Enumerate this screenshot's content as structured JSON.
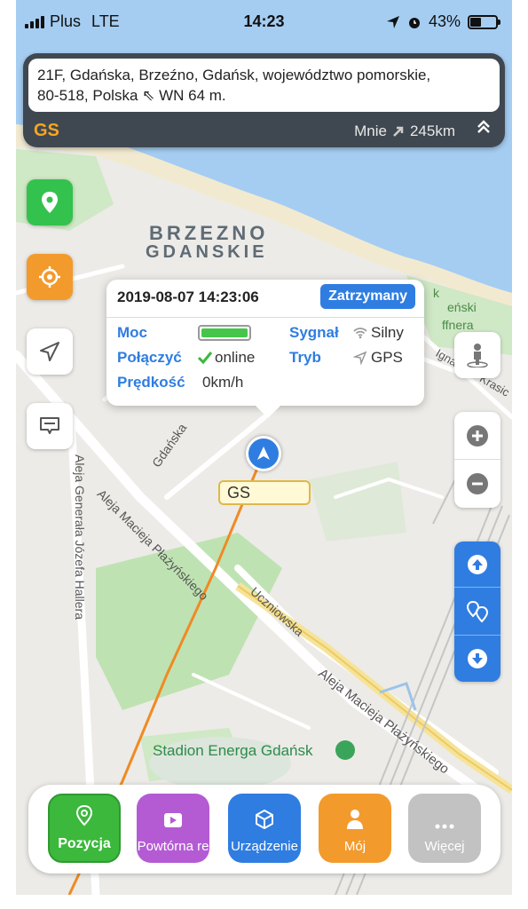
{
  "status_bar": {
    "carrier": "Plus",
    "network": "LTE",
    "time": "14:23",
    "battery_percent": "43%",
    "battery_level": 0.43
  },
  "address": {
    "text_line1": "21F, Gdańska, Brzeźno, Gdańsk, województwo pomorskie,",
    "text_line2": "80-518, Polska ⇖ WN 64 m.",
    "device_name": "GS",
    "distance_label": "Mnie",
    "distance_value": "245km"
  },
  "map": {
    "area_label_line1": "BRZEZNO",
    "area_label_line2": "GDANSKIE",
    "streets": [
      "Gdańska",
      "Aleja Macieja Płażyńskiego",
      "Uczniowska",
      "Aleja Generała Józefa Hallera",
      "Aleja Macieja Płażyńskiego",
      "Ignacego Krasic"
    ],
    "poi": "Stadion Energa Gdańsk",
    "partial_labels": [
      "eński",
      "ffnera",
      "k"
    ],
    "marker_label": "GS"
  },
  "popup": {
    "datetime": "2019-08-07 14:23:06",
    "status": "Zatrzymany",
    "power_label": "Moc",
    "signal_label": "Sygnał",
    "signal_value": "Silny",
    "connect_label": "Połączyć",
    "connect_value": "online",
    "mode_label": "Tryb",
    "mode_value": "GPS",
    "speed_label": "Prędkość",
    "speed_value": "0km/h"
  },
  "bottom_nav": [
    {
      "label": "Pozycja",
      "color": "#3cb83c"
    },
    {
      "label": "Powtórna re",
      "color": "#b45bd4"
    },
    {
      "label": "Urządzenie",
      "color": "#2f7de1"
    },
    {
      "label": "Mój",
      "color": "#f39a2d"
    },
    {
      "label": "Więcej",
      "color": "#c2c2c2"
    }
  ],
  "colors": {
    "accent_blue": "#2f7de1",
    "green": "#33c24d",
    "orange": "#f39a2d",
    "device_name": "#f5a623",
    "sea": "#a5cdf2"
  },
  "icons": [
    "location-pin-icon",
    "target-icon",
    "send-icon",
    "message-icon",
    "street-view-icon",
    "zoom-in-icon",
    "zoom-out-icon",
    "arrow-up-icon",
    "multi-pin-icon",
    "arrow-down-icon",
    "navigation-arrow-icon",
    "cube-icon",
    "user-icon",
    "more-icon",
    "video-icon"
  ]
}
